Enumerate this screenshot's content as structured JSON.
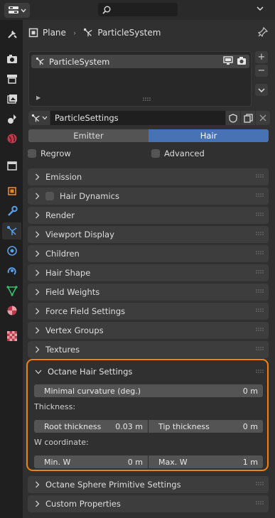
{
  "header": {
    "search_placeholder": ""
  },
  "breadcrumb": {
    "object": "Plane",
    "system": "ParticleSystem"
  },
  "particle_list": {
    "items": [
      "ParticleSystem"
    ]
  },
  "settings": {
    "name": "ParticleSettings"
  },
  "type_toggle": {
    "options": [
      "Emitter",
      "Hair"
    ],
    "selected": "Hair"
  },
  "checkboxes": {
    "regrow": "Regrow",
    "advanced": "Advanced"
  },
  "panels": [
    "Emission",
    "Hair Dynamics",
    "Render",
    "Viewport Display",
    "Children",
    "Hair Shape",
    "Field Weights",
    "Force Field Settings",
    "Vertex Groups",
    "Textures"
  ],
  "octane": {
    "title": "Octane Hair Settings",
    "minimal_curvature_label": "Minimal curvature (deg.)",
    "minimal_curvature_value": "0 m",
    "thickness_label": "Thickness:",
    "root_thickness_label": "Root thickness",
    "root_thickness_value": "0.03 m",
    "tip_thickness_label": "Tip thickness",
    "tip_thickness_value": "0 m",
    "w_coordinate_label": "W coordinate:",
    "min_w_label": "Min. W",
    "min_w_value": "0 m",
    "max_w_label": "Max. W",
    "max_w_value": "1 m"
  },
  "bottom_panels": [
    "Octane Sphere Primitive Settings",
    "Custom Properties"
  ],
  "colors": {
    "accent_blue": "#4772b3",
    "highlight_orange": "#f0820f",
    "panel_bg": "#3d3d3d",
    "background": "#303030"
  },
  "icons": {
    "tabs": [
      "tool-icon",
      "render-icon",
      "output-icon",
      "view-layer-icon",
      "scene-icon",
      "world-icon",
      "collection-icon",
      "object-icon",
      "modifier-icon",
      "particles-icon",
      "physics-icon",
      "constraints-icon",
      "object-data-icon",
      "material-icon",
      "texture-icon"
    ]
  }
}
